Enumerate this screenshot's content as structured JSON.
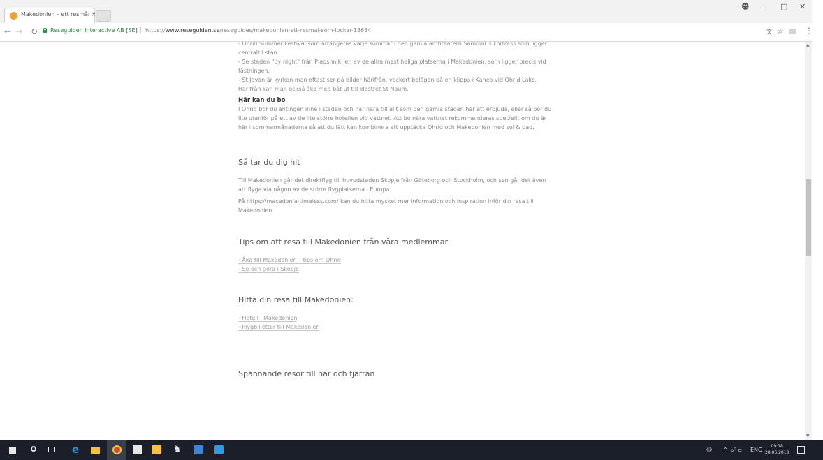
{
  "browser": {
    "tab_title": "Makedonien – ett resmål ×",
    "site_identity": "Reseguiden Interactive AB [SE]",
    "url_separator": "|",
    "url_prefix": "https://",
    "url_host": "www.reseguiden.se",
    "url_path": "/reseguides/makedonien-ett-resmal-som-lockar-13684",
    "icons": [
      "back-arrow-icon",
      "forward-arrow-icon",
      "reload-icon",
      "lock-icon",
      "translate-icon",
      "star-icon",
      "extension-icon",
      "menu-icon"
    ]
  },
  "article": {
    "intro_bullets": [
      "- Ohrid Summer Festival som arrangeras varje sommar i den gamla amfiteatern Samouil´s Fortress som ligger",
      "centralt i stan.",
      "- Se staden \"by night\" från Plaoshnik, en av de allra mest heliga platserna i Makedonien, som ligger precis vid",
      "fästningen.",
      "- St Jovan är kyrkan man oftast ser på bilder härifrån, vackert belägen på en klippa i Kaneo vid Ohrid Lake.",
      "Härifrån kan man också åka med båt ut till klostret St Naum."
    ],
    "stay": {
      "heading": "Här kan du bo",
      "lines": [
        "I Ohrid bor du antingen inne i staden och har nära till allt som den gamla staden har att erbjuda, eller så bor du",
        "lite utanför på ett av de lite större hotellen vid vattnet. Att bo nära vattnet rekommenderas speciellt om du är",
        "här i sommarmånaderna så att du lätt kan kombinera att upptäcka Ohrid och Makedonien med sol & bad."
      ]
    },
    "getting_there": {
      "heading": "Så tar du dig hit",
      "p1": [
        "Till Makedonien går det direktflyg till huvudstaden Skopje från Göteborg och Stockholm, och sen går det även",
        "att flyga via någon av de större flygplatserna i Europa."
      ],
      "p2": [
        "På https://macedonia-timeless.com/ kan du hitta mycket mer information och inspiration inför din resa till",
        "Makedonien."
      ]
    },
    "tips": {
      "heading": "Tips om att resa till Makedonien från våra medlemmar",
      "links": [
        "- Åka till Makedonien – tips om Ohrid",
        "- Se och göra i Skopje"
      ]
    },
    "find": {
      "heading": "Hitta din resa till Makedonien:",
      "links": [
        "- Hotell i Makedonien",
        "- Flygbiljetter till Makedonien"
      ]
    },
    "more_heading": "Spännande resor till när och fjärran"
  },
  "taskbar": {
    "icons": [
      "windows-start-icon",
      "search-icon",
      "task-view-icon",
      "edge-icon",
      "file-explorer-icon",
      "chrome-icon",
      "store-icon",
      "sticky-notes-icon",
      "app-icon",
      "app-icon",
      "app-icon"
    ],
    "tray_lang": "ENG",
    "time": "09:18",
    "date": "28.06.2018"
  }
}
